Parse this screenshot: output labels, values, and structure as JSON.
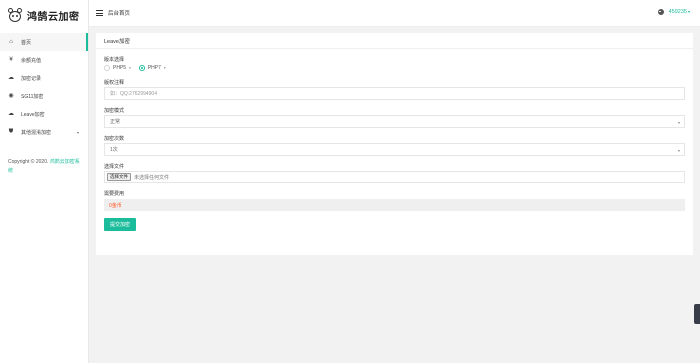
{
  "brand": {
    "name": "鸿鹄云加密"
  },
  "header": {
    "title": "后台首页",
    "user": "459235",
    "user_caret": "▾"
  },
  "sidebar": {
    "items": [
      {
        "label": "首页",
        "icon": "home-icon",
        "glyph": "⌂"
      },
      {
        "label": "余额充值",
        "icon": "yen-icon",
        "glyph": "¥"
      },
      {
        "label": "加密记录",
        "icon": "cloud-icon",
        "glyph": "☁"
      },
      {
        "label": "SG11加密",
        "icon": "eye-icon",
        "glyph": "◉"
      },
      {
        "label": "Leave加密",
        "icon": "cloud-upload-icon",
        "glyph": "☁"
      },
      {
        "label": "其他混淆加密",
        "icon": "shield-icon",
        "glyph": "⛊",
        "arrow": "▾"
      }
    ],
    "copyright_prefix": "Copyright © 2020.",
    "copyright_link": "鸿鹄云加密系统"
  },
  "card": {
    "title": "Leave加密",
    "version_label": "版本选择",
    "version_options": [
      {
        "label": "PHP5",
        "caret": "▾",
        "checked": false
      },
      {
        "label": "PHP7",
        "caret": "▾",
        "checked": true
      }
    ],
    "comment_label": "版权注释",
    "comment_placeholder": "如：QQ:2762994904",
    "mode_label": "加密模式",
    "mode_value": "正常",
    "times_label": "加密次数",
    "times_value": "1次",
    "file_label": "选择文件",
    "file_button": "选择文件",
    "file_status": "未选择任何文件",
    "cost_label": "需要费用",
    "cost_value": "0金币",
    "submit_label": "提交加密"
  },
  "colors": {
    "accent": "#1bbc9b",
    "cost": "#ff5722",
    "side_tab": "#393d49"
  }
}
